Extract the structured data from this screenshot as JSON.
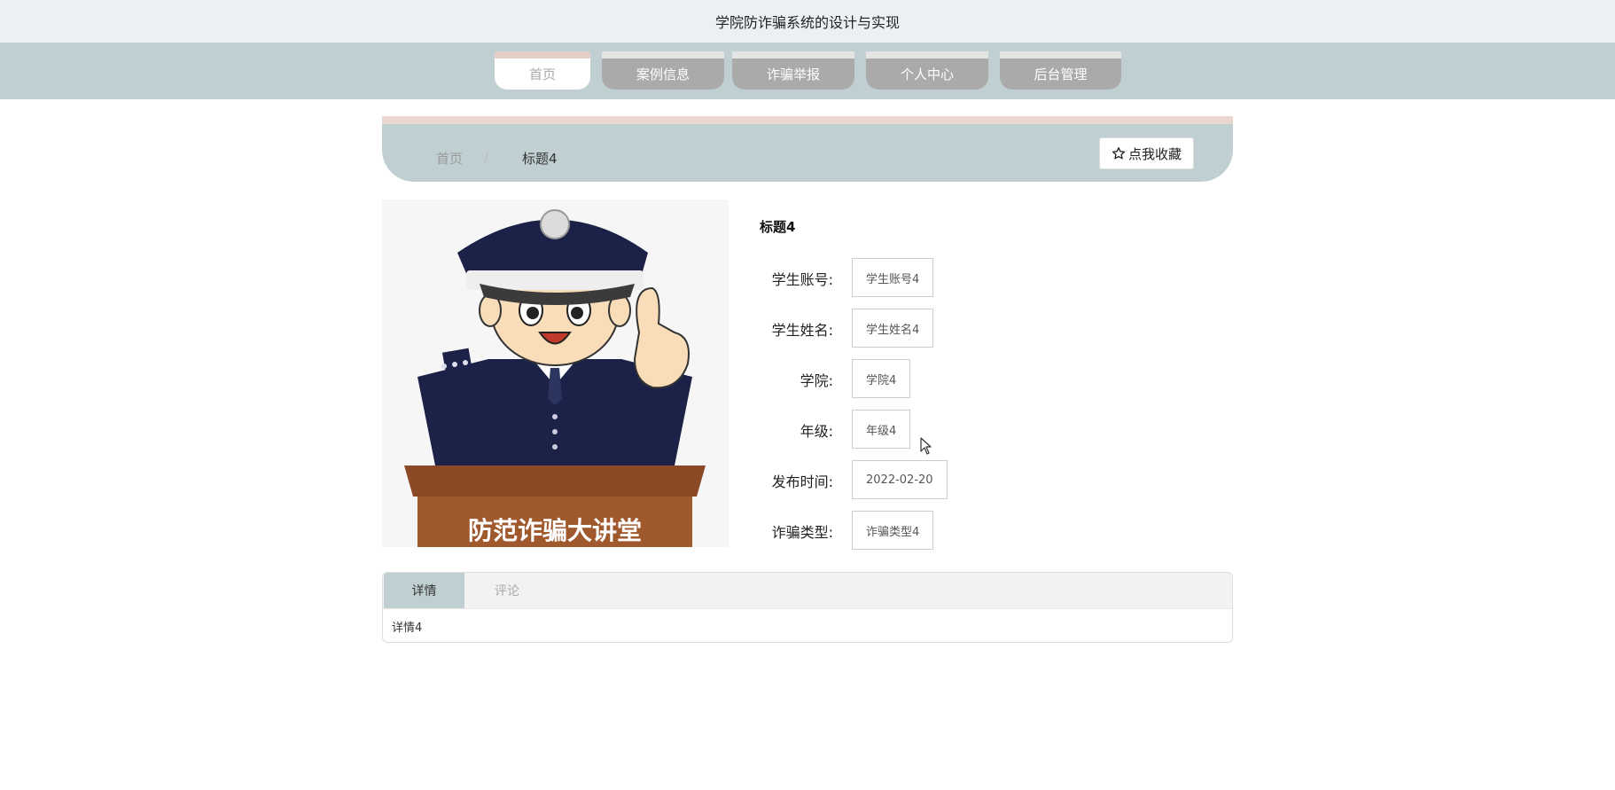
{
  "site": {
    "title": "学院防诈骗系统的设计与实现"
  },
  "nav": {
    "items": [
      {
        "label": "首页",
        "active": true
      },
      {
        "label": "案例信息",
        "active": false
      },
      {
        "label": "诈骗举报",
        "active": false
      },
      {
        "label": "个人中心",
        "active": false
      },
      {
        "label": "后台管理",
        "active": false
      }
    ]
  },
  "breadcrumb": {
    "home": "首页",
    "separator": "/",
    "current": "标题4"
  },
  "favorite": {
    "icon": "star-outline-icon",
    "label": "点我收藏"
  },
  "poster": {
    "text": "防范诈骗大讲堂"
  },
  "detail": {
    "title": "标题4",
    "fields": [
      {
        "label": "学生账号:",
        "value": "学生账号4"
      },
      {
        "label": "学生姓名:",
        "value": "学生姓名4"
      },
      {
        "label": "学院:",
        "value": "学院4"
      },
      {
        "label": "年级:",
        "value": "年级4"
      },
      {
        "label": "发布时间:",
        "value": "2022-02-20"
      },
      {
        "label": "诈骗类型:",
        "value": "诈骗类型4"
      }
    ]
  },
  "tabs": {
    "items": [
      {
        "label": "详情",
        "active": true
      },
      {
        "label": "评论",
        "active": false
      }
    ],
    "content": "详情4"
  },
  "colors": {
    "nav_bg": "#c0d0d2",
    "nav_item": "#aaaaaa",
    "accent_top": "#ead8d0"
  }
}
